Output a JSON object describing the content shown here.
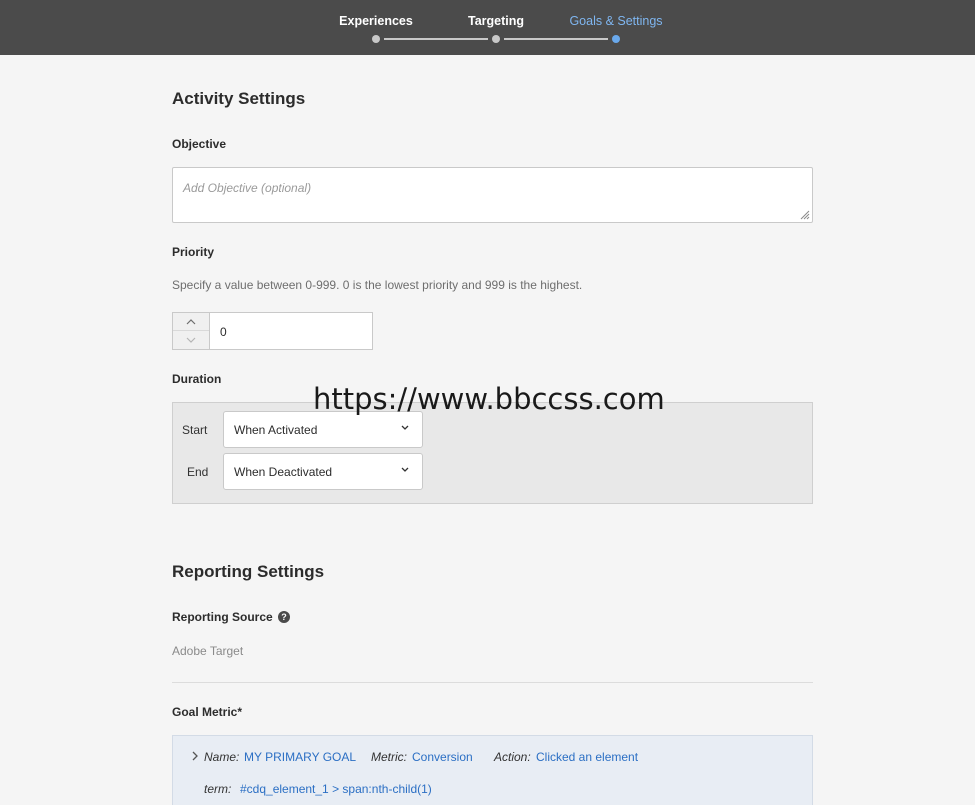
{
  "stepper": {
    "steps": [
      {
        "label": "Experiences",
        "active": false
      },
      {
        "label": "Targeting",
        "active": false
      },
      {
        "label": "Goals & Settings",
        "active": true
      }
    ]
  },
  "activity": {
    "title": "Activity Settings",
    "objective_label": "Objective",
    "objective_placeholder": "Add Objective (optional)",
    "objective_value": "",
    "priority_label": "Priority",
    "priority_help": "Specify a value between 0-999. 0 is the lowest priority and 999 is the highest.",
    "priority_value": "0",
    "duration_label": "Duration",
    "start_label": "Start",
    "start_value": "When Activated",
    "end_label": "End",
    "end_value": "When Deactivated"
  },
  "reporting": {
    "title": "Reporting Settings",
    "source_label": "Reporting Source",
    "source_value": "Adobe Target",
    "goal_metric_label": "Goal Metric*",
    "goal": {
      "name_key": "Name:",
      "name_value": "MY PRIMARY GOAL",
      "metric_key": "Metric:",
      "metric_value": "Conversion",
      "action_key": "Action:",
      "action_value": "Clicked an element",
      "term_key": "term:",
      "term_value": "#cdq_element_1 > span:nth-child(1)"
    }
  },
  "watermark": "https://www.bbccss.com",
  "colors": {
    "topbar": "#4b4b4b",
    "active_step": "#7fb6f0",
    "link": "#2b6fc4"
  }
}
